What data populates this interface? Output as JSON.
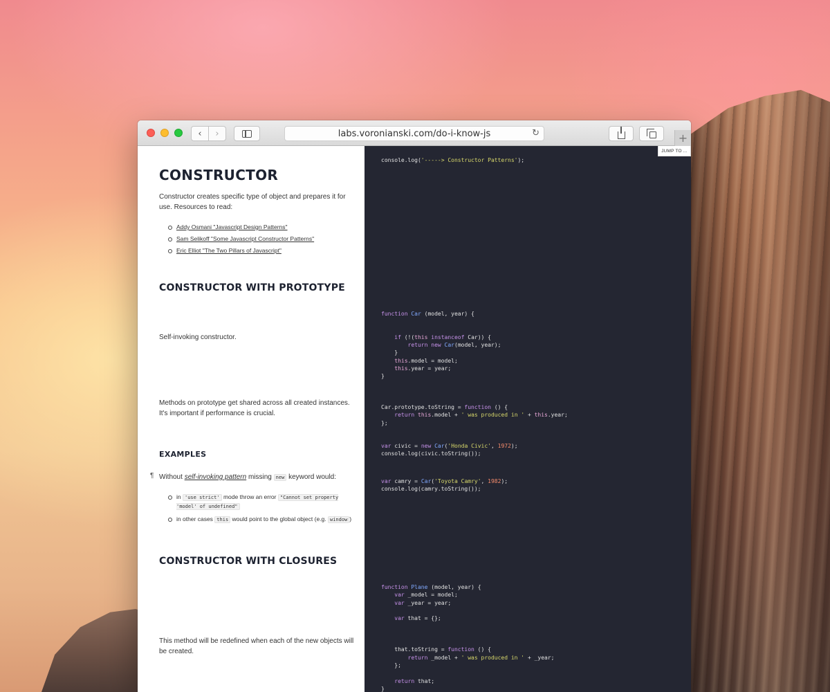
{
  "browser": {
    "url": "labs.voronianski.com/do-i-know-js",
    "jump_to_label": "JUMP TO ...",
    "new_tab_symbol": "+"
  },
  "article": {
    "section1_title": "CONSTRUCTOR",
    "section1_intro": "Constructor creates specific type of object and prepares it for use. Resources to read:",
    "resources": [
      "Addy Osmani \"Javascript Design Patterns\"",
      "Sam Selikoff \"Some Javascript Constructor Patterns\"",
      "Eric Elliot \"The Two Pillars of Javascript\""
    ],
    "section2_title": "CONSTRUCTOR WITH PROTOTYPE",
    "self_invoking_text": "Self-invoking constructor.",
    "prototype_text": "Methods on prototype get shared across all created instances. It's important if performance is crucial.",
    "examples_title": "EXAMPLES",
    "example_pilcrow": "¶",
    "example_prefix": "Without",
    "example_link": "self-invoking pattern",
    "example_middle": "missing",
    "example_keyword": "new",
    "example_suffix": "keyword would:",
    "bullet1_pre": "in",
    "bullet1_code1": "'use strict'",
    "bullet1_mid": "mode throw an error",
    "bullet1_code2": "\"Cannot set property 'model' of undefined\"",
    "bullet2_pre": "in other cases",
    "bullet2_code1": "this",
    "bullet2_mid": "would point to the global object (e.g.",
    "bullet2_code2": "window",
    "bullet2_end": ")",
    "section3_title": "CONSTRUCTOR WITH CLOSURES",
    "closures_text": "This method will be redefined when each of the new objects will be created."
  },
  "code": {
    "block1": "console.log('-----> Constructor Patterns');",
    "block2_lines": [
      "function Car (model, year) {",
      "",
      "",
      "    if (!(this instanceof Car)) {",
      "        return new Car(model, year);",
      "    }",
      "    this.model = model;",
      "    this.year = year;",
      "}"
    ],
    "block3_lines": [
      "Car.prototype.toString = function () {",
      "    return this.model + ' was produced in ' + this.year;",
      "};"
    ],
    "block4_lines": [
      "var civic = new Car('Honda Civic', 1972);",
      "console.log(civic.toString());"
    ],
    "block5_lines": [
      "var camry = Car('Toyota Camry', 1982);",
      "console.log(camry.toString());"
    ],
    "block6_lines": [
      "function Plane (model, year) {",
      "    var _model = model;",
      "    var _year = year;",
      "",
      "    var that = {};",
      "",
      "",
      "",
      "    that.toString = function () {",
      "        return _model + ' was produced in ' + _year;",
      "    };",
      "",
      "    return that;",
      "}"
    ]
  },
  "icons": {
    "back": "chevron-left-icon",
    "forward": "chevron-right-icon",
    "sidebar": "sidebar-icon",
    "reload": "reload-icon",
    "share": "share-icon",
    "tabs": "tabs-icon"
  },
  "colors": {
    "code_background": "#242632",
    "heading": "#1d2230"
  }
}
